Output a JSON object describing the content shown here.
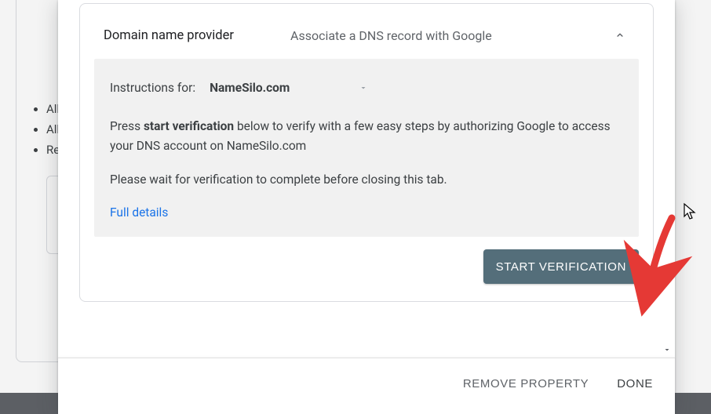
{
  "background": {
    "bullets": [
      "All",
      "All",
      "Re"
    ]
  },
  "dialog": {
    "card": {
      "title": "Domain name provider",
      "subtitle": "Associate a DNS record with Google"
    },
    "panel": {
      "instructions_label": "Instructions for:",
      "provider_selected": "NameSilo.com",
      "p1": "Press start verification below to verify with a few easy steps by authorizing Google to access your DNS account on NameSilo.com",
      "p1_bold": "start verification",
      "p2": "Please wait for verification to complete before closing this tab.",
      "full_details": "Full details"
    },
    "start_button": "START VERIFICATION",
    "footer": {
      "remove": "REMOVE PROPERTY",
      "done": "DONE"
    }
  }
}
